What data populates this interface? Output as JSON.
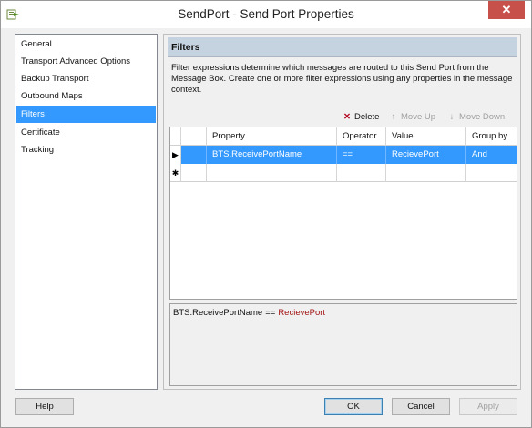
{
  "window": {
    "title": "SendPort - Send Port Properties",
    "close_label": "✕"
  },
  "nav": {
    "items": [
      {
        "label": "General"
      },
      {
        "label": "Transport Advanced Options"
      },
      {
        "label": "Backup Transport"
      },
      {
        "label": "Outbound Maps"
      },
      {
        "label": "Filters"
      },
      {
        "label": "Certificate"
      },
      {
        "label": "Tracking"
      }
    ],
    "selected": "Filters"
  },
  "panel": {
    "title": "Filters",
    "description": "Filter expressions determine which messages are routed to this Send Port from the Message Box. Create one or more filter expressions using any properties in the message context."
  },
  "toolbar": {
    "delete_label": "Delete",
    "move_up_label": "Move Up",
    "move_down_label": "Move Down"
  },
  "grid": {
    "columns": [
      "Property",
      "Operator",
      "Value",
      "Group by"
    ],
    "rows": [
      {
        "marker": "▶",
        "property": "BTS.ReceivePortName",
        "operator": "==",
        "value": "RecievePort",
        "group_by": "And"
      },
      {
        "marker": "✱",
        "property": "",
        "operator": "",
        "value": "",
        "group_by": ""
      }
    ]
  },
  "expression": {
    "left": "BTS.ReceivePortName",
    "op": "==",
    "right": "RecievePort"
  },
  "buttons": {
    "help": "Help",
    "ok": "OK",
    "cancel": "Cancel",
    "apply": "Apply"
  },
  "colors": {
    "selection": "#3399ff",
    "panel_header": "#c5d2e0",
    "close_button": "#c7504b",
    "expression_value": "#a31515"
  },
  "icons": {
    "app": "send-port-icon",
    "delete": "delete-x-icon",
    "move_up": "arrow-up-icon",
    "move_down": "arrow-down-icon",
    "current_row": "row-pointer-icon",
    "new_row": "new-row-asterisk-icon"
  }
}
